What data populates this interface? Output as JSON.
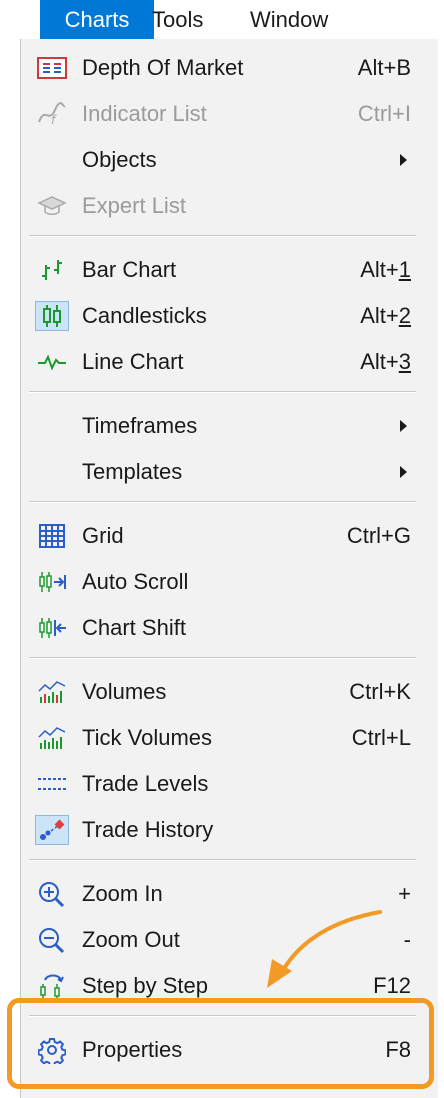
{
  "menubar": {
    "items": [
      "Charts",
      "Tools",
      "Window"
    ],
    "active": "Charts"
  },
  "menu": {
    "items": [
      {
        "label": "Depth Of Market",
        "shortcut": "Alt+B",
        "icon": "depth-of-market-icon"
      },
      {
        "label": "Indicator List",
        "shortcut": "Ctrl+I",
        "icon": "indicator-list-icon",
        "disabled": true
      },
      {
        "label": "Objects",
        "icon": "none",
        "submenu": true
      },
      {
        "label": "Expert List",
        "icon": "expert-list-icon",
        "disabled": true
      },
      {
        "label": "Bar Chart",
        "shortcut_prefix": "Alt+",
        "shortcut_key": "1",
        "icon": "bar-chart-icon"
      },
      {
        "label": "Candlesticks",
        "shortcut_prefix": "Alt+",
        "shortcut_key": "2",
        "icon": "candlesticks-icon",
        "checked": true
      },
      {
        "label": "Line Chart",
        "shortcut_prefix": "Alt+",
        "shortcut_key": "3",
        "icon": "line-chart-icon"
      },
      {
        "label": "Timeframes",
        "icon": "none",
        "submenu": true
      },
      {
        "label": "Templates",
        "icon": "none",
        "submenu": true
      },
      {
        "label": "Grid",
        "shortcut": "Ctrl+G",
        "icon": "grid-icon"
      },
      {
        "label": "Auto Scroll",
        "icon": "auto-scroll-icon"
      },
      {
        "label": "Chart Shift",
        "icon": "chart-shift-icon"
      },
      {
        "label": "Volumes",
        "shortcut": "Ctrl+K",
        "icon": "volumes-icon"
      },
      {
        "label": "Tick Volumes",
        "shortcut": "Ctrl+L",
        "icon": "tick-volumes-icon"
      },
      {
        "label": "Trade Levels",
        "icon": "trade-levels-icon"
      },
      {
        "label": "Trade History",
        "icon": "trade-history-icon",
        "checked": true
      },
      {
        "label": "Zoom In",
        "shortcut": "+",
        "icon": "zoom-in-icon"
      },
      {
        "label": "Zoom Out",
        "shortcut": "-",
        "icon": "zoom-out-icon"
      },
      {
        "label": "Step by Step",
        "shortcut": "F12",
        "icon": "step-by-step-icon"
      },
      {
        "label": "Properties",
        "shortcut": "F8",
        "icon": "gear-icon"
      }
    ]
  },
  "colors": {
    "menubar_active": "#0078d7",
    "menu_background": "#f2f2f2",
    "highlight_border": "#f39a26",
    "annotation_arrow": "#f39a26"
  }
}
